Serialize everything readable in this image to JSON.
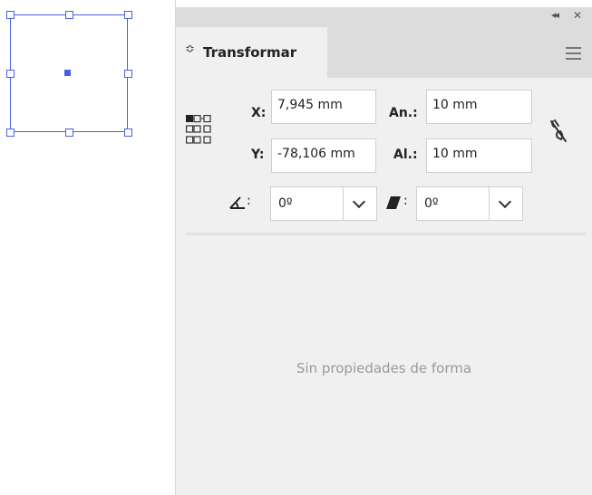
{
  "panel": {
    "tab_label": "Transformar",
    "tab_arrow": "≎",
    "collapse_glyph": "◂◂",
    "close_glyph": "✕",
    "menu_icon": "hamburger-icon"
  },
  "transform": {
    "x_label": "X:",
    "x_value": "7,945 mm",
    "y_label": "Y:",
    "y_value": "-78,106 mm",
    "width_label": "An.:",
    "width_value": "10 mm",
    "height_label": "Al.:",
    "height_value": "10 mm",
    "angle_label": ":",
    "angle_value": "0º",
    "shear_label": ":",
    "shear_value": "0º"
  },
  "empty_message": "Sin propiedades de forma",
  "colors": {
    "selection": "#4a5fe8",
    "panel_bg": "#f0f0f0",
    "tab_bar_bg": "#dcdcdc"
  }
}
